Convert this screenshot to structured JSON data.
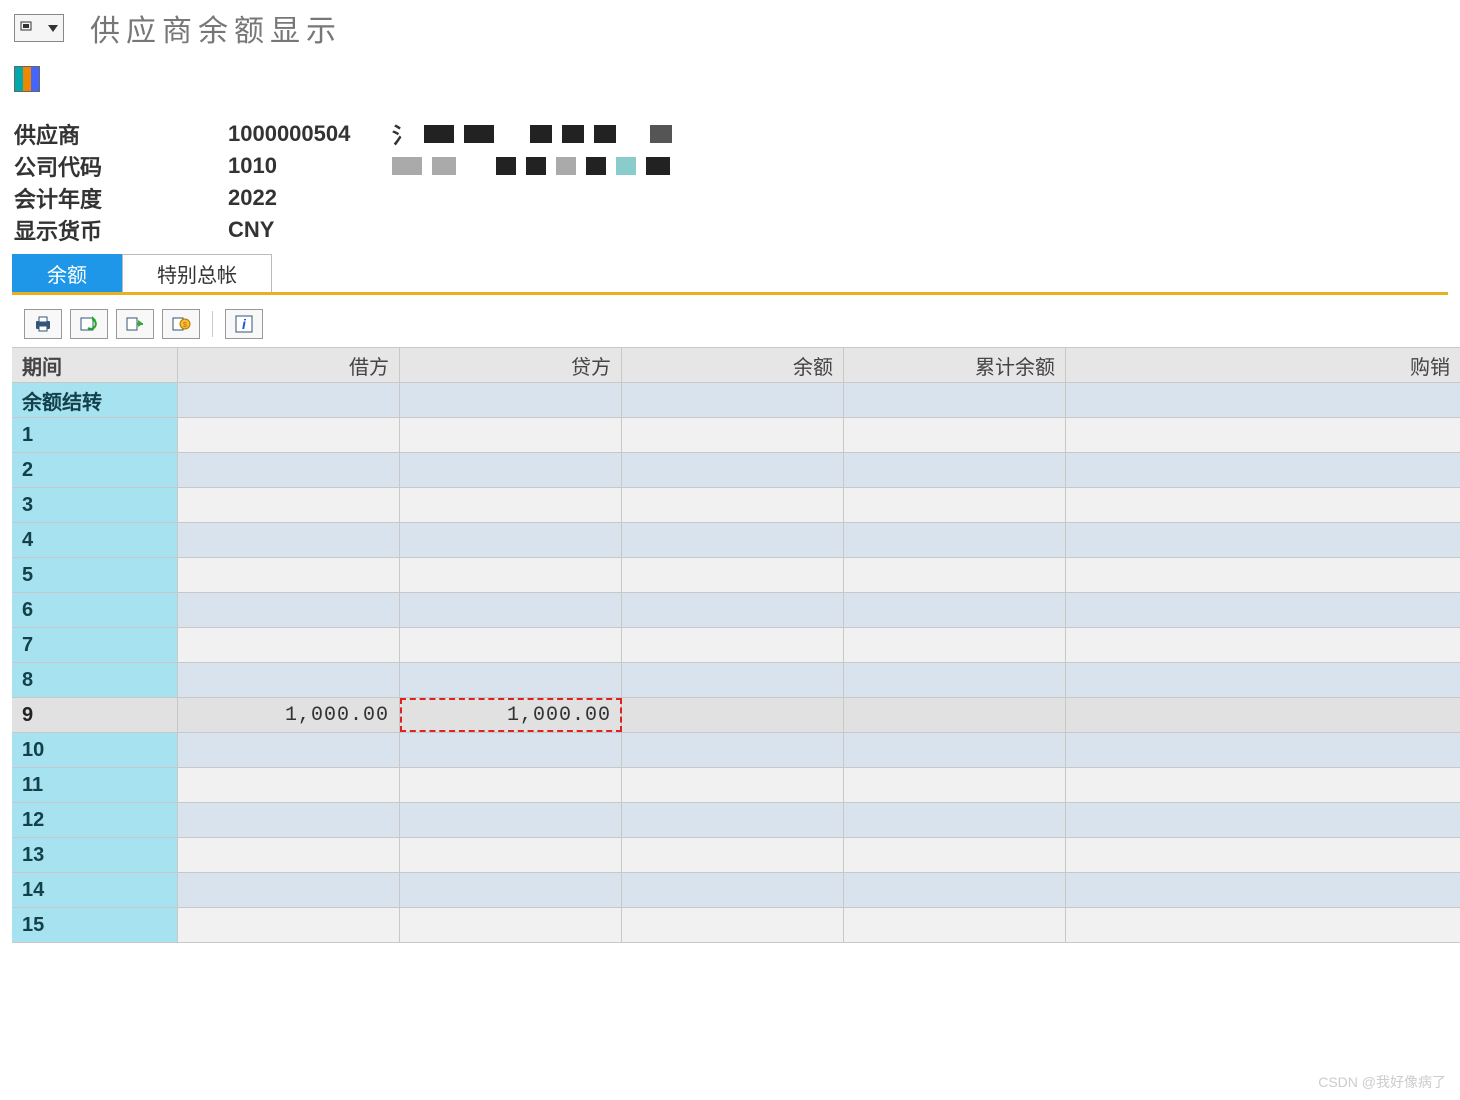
{
  "title": "供应商余额显示",
  "header": {
    "vendor_label": "供应商",
    "vendor_value": "1000000504",
    "company_label": "公司代码",
    "company_value": "1010",
    "fy_label": "会计年度",
    "fy_value": "2022",
    "currency_label": "显示货币",
    "currency_value": "CNY"
  },
  "tabs": {
    "balance": "余额",
    "special": "特别总帐"
  },
  "columns": {
    "period": "期间",
    "debit": "借方",
    "credit": "贷方",
    "balance": "余额",
    "cumulative": "累计余额",
    "purchase": "购销"
  },
  "rows": [
    {
      "period": "余额结转",
      "debit": "",
      "credit": "",
      "balance": "",
      "cumulative": "",
      "purchase": ""
    },
    {
      "period": "1",
      "debit": "",
      "credit": "",
      "balance": "",
      "cumulative": "",
      "purchase": ""
    },
    {
      "period": "2",
      "debit": "",
      "credit": "",
      "balance": "",
      "cumulative": "",
      "purchase": ""
    },
    {
      "period": "3",
      "debit": "",
      "credit": "",
      "balance": "",
      "cumulative": "",
      "purchase": ""
    },
    {
      "period": "4",
      "debit": "",
      "credit": "",
      "balance": "",
      "cumulative": "",
      "purchase": ""
    },
    {
      "period": "5",
      "debit": "",
      "credit": "",
      "balance": "",
      "cumulative": "",
      "purchase": ""
    },
    {
      "period": "6",
      "debit": "",
      "credit": "",
      "balance": "",
      "cumulative": "",
      "purchase": ""
    },
    {
      "period": "7",
      "debit": "",
      "credit": "",
      "balance": "",
      "cumulative": "",
      "purchase": ""
    },
    {
      "period": "8",
      "debit": "",
      "credit": "",
      "balance": "",
      "cumulative": "",
      "purchase": ""
    },
    {
      "period": "9",
      "debit": "1,000.00",
      "credit": "1,000.00",
      "balance": "",
      "cumulative": "",
      "purchase": "",
      "selected": true,
      "highlight_credit": true
    },
    {
      "period": "10",
      "debit": "",
      "credit": "",
      "balance": "",
      "cumulative": "",
      "purchase": ""
    },
    {
      "period": "11",
      "debit": "",
      "credit": "",
      "balance": "",
      "cumulative": "",
      "purchase": ""
    },
    {
      "period": "12",
      "debit": "",
      "credit": "",
      "balance": "",
      "cumulative": "",
      "purchase": ""
    },
    {
      "period": "13",
      "debit": "",
      "credit": "",
      "balance": "",
      "cumulative": "",
      "purchase": ""
    },
    {
      "period": "14",
      "debit": "",
      "credit": "",
      "balance": "",
      "cumulative": "",
      "purchase": ""
    },
    {
      "period": "15",
      "debit": "",
      "credit": "",
      "balance": "",
      "cumulative": "",
      "purchase": ""
    }
  ],
  "watermark": "CSDN @我好像病了"
}
